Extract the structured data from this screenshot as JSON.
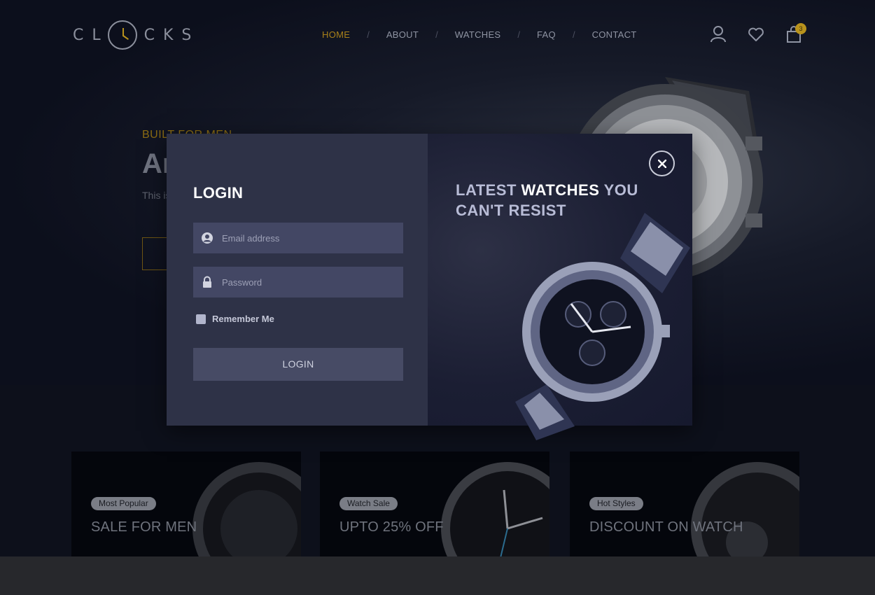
{
  "brand": {
    "logo_left": "CL",
    "logo_right": "CKS"
  },
  "nav": {
    "items": [
      {
        "label": "HOME",
        "active": true
      },
      {
        "label": "ABOUT"
      },
      {
        "label": "WATCHES"
      },
      {
        "label": "FAQ"
      },
      {
        "label": "CONTACT"
      }
    ],
    "separator": "/"
  },
  "header_icons": {
    "account": "user-icon",
    "wishlist": "heart-icon",
    "cart": "shopping-bag-icon",
    "cart_count": "3"
  },
  "hero": {
    "tag": "BUILT FOR MEN",
    "title_partial": "Ar",
    "text_partial": "This is watch quali"
  },
  "promos": [
    {
      "badge": "Most Popular",
      "title": "SALE FOR MEN"
    },
    {
      "badge": "Watch Sale",
      "title": "UPTO 25% OFF"
    },
    {
      "badge": "Hot Styles",
      "title": "DISCOUNT ON WATCH"
    }
  ],
  "modal": {
    "title": "LOGIN",
    "email": {
      "placeholder": "Email address",
      "icon": "user-circle-icon"
    },
    "password": {
      "placeholder": "Password",
      "icon": "lock-icon"
    },
    "remember_label": "Remember Me",
    "submit_label": "LOGIN",
    "headline": {
      "part1": "LATEST ",
      "strong": "WATCHES",
      "part2": " YOU CAN'T RESIST"
    },
    "close_icon": "close-icon"
  },
  "colors": {
    "accent": "#b8921c",
    "modal_left": "#2e3247",
    "modal_right": "#1b1e33",
    "field": "#434764"
  }
}
